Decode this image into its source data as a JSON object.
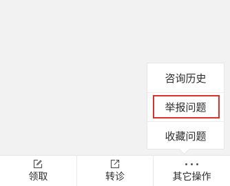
{
  "popup_menu": {
    "items": [
      {
        "label": "咨询历史"
      },
      {
        "label": "举报问题",
        "highlighted": true
      },
      {
        "label": "收藏问题"
      }
    ],
    "highlight_color": "#d9302c"
  },
  "toolbar": {
    "buttons": [
      {
        "label": "领取",
        "icon": "edit-icon"
      },
      {
        "label": "转诊",
        "icon": "share-icon"
      },
      {
        "label": "其它操作",
        "icon": "more-dots-icon"
      }
    ]
  }
}
